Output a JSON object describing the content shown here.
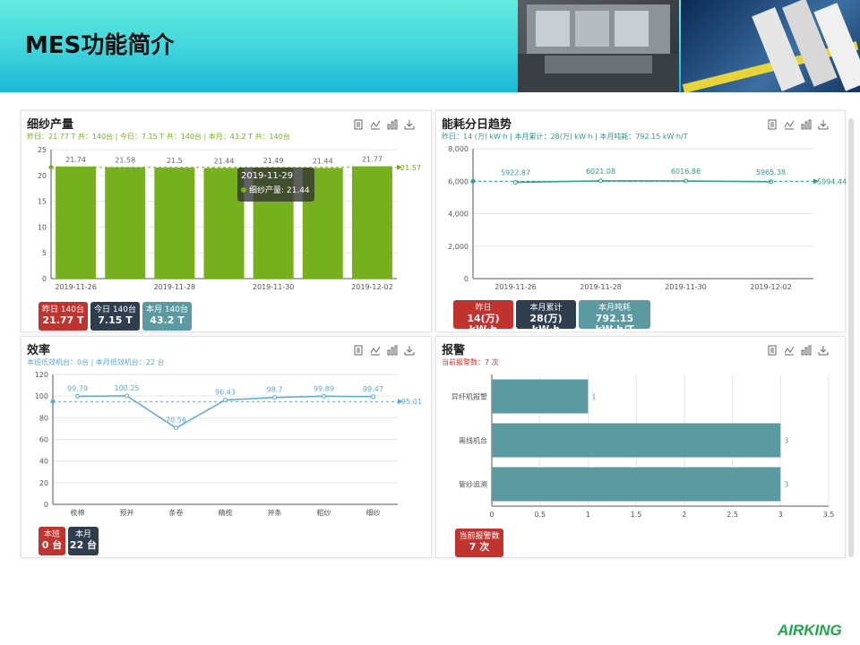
{
  "page": {
    "title": "MES功能简介",
    "logo": "AIRKING"
  },
  "colors": {
    "green": "#76b01e",
    "teal": "#2e9c86",
    "blue": "#5aa9d8",
    "slate": "#5b9aa0",
    "red": "#c1332f",
    "navy": "#2f3e4f"
  },
  "toolbar_icons": [
    "data-view-icon",
    "line-switch-icon",
    "bar-switch-icon",
    "download-icon"
  ],
  "yarn": {
    "title": "细纱产量",
    "summary": "昨日：21.77 T 共：140台 | 今日：7.15 T 共：140台 | 本月：43.2 T  共：140台",
    "tooltip": {
      "date": "2019-11-29",
      "text": "细纱产量: 21.44"
    },
    "badges": [
      {
        "label": "昨日 140台",
        "value": "21.77 T",
        "color": "#c1332f"
      },
      {
        "label": "今日 140台",
        "value": "7.15 T",
        "color": "#2f3e4f"
      },
      {
        "label": "本月 140台",
        "value": "43.2 T",
        "color": "#5b9aa0"
      }
    ]
  },
  "energy": {
    "title": "能耗分日趋势",
    "summary": "昨日：14 (万) kW·h | 本月累计：28(万) kW·h | 本月吨耗：792.15 kW·h/T",
    "badges": [
      {
        "label": "昨日",
        "value": "14(万) kW·h",
        "color": "#c1332f"
      },
      {
        "label": "本月累计",
        "value": "28(万) kW·h",
        "color": "#2f3e4f"
      },
      {
        "label": "本月吨耗",
        "value": "792.15 kW·h/T",
        "color": "#5b9aa0"
      }
    ]
  },
  "efficiency": {
    "title": "效率",
    "summary": "本班低效机台：0台 | 本月低效机台：22 台",
    "badges": [
      {
        "label": "本班",
        "value": "0 台",
        "color": "#c1332f"
      },
      {
        "label": "本月",
        "value": "22 台",
        "color": "#2f3e4f"
      }
    ]
  },
  "alarm": {
    "title": "报警",
    "summary": "当前报警数：7 次",
    "badges": [
      {
        "label": "当前报警数",
        "value": "7 次",
        "color": "#c1332f"
      }
    ]
  },
  "chart_data": [
    {
      "id": "yarn",
      "type": "bar",
      "categories": [
        "2019-11-26",
        "2019-11-27",
        "2019-11-28",
        "2019-11-29",
        "2019-11-30",
        "2019-12-01",
        "2019-12-02"
      ],
      "x_tick_labels": [
        "2019-11-26",
        "2019-11-28",
        "2019-11-30",
        "2019-12-02"
      ],
      "values": [
        21.74,
        21.58,
        21.5,
        21.44,
        21.49,
        21.44,
        21.77
      ],
      "average": 21.57,
      "ylim": [
        0,
        25
      ],
      "yticks": [
        0,
        5,
        10,
        15,
        20,
        25
      ],
      "grid": true
    },
    {
      "id": "energy",
      "type": "line",
      "x": [
        "2019-11-26",
        "2019-11-28",
        "2019-11-30",
        "2019-12-02"
      ],
      "values": [
        5922.87,
        6021.08,
        6016.86,
        5965.38
      ],
      "value_labels": [
        "5922.87",
        "6021.08",
        "6016.86",
        "5965.38"
      ],
      "average": 5994.44,
      "ylim": [
        0,
        8000
      ],
      "yticks": [
        0,
        2000,
        4000,
        6000,
        8000
      ],
      "ytick_labels": [
        "0",
        "2,000",
        "4,000",
        "6,000",
        "8,000"
      ],
      "grid": true
    },
    {
      "id": "efficiency",
      "type": "line",
      "categories": [
        "梳棉",
        "预并",
        "条卷",
        "精梳",
        "并条",
        "粗纱",
        "细纱"
      ],
      "values": [
        99.79,
        100.25,
        70.56,
        96.43,
        98.7,
        99.89,
        99.47
      ],
      "average": 95.01,
      "ylim": [
        0,
        120
      ],
      "yticks": [
        0,
        20,
        40,
        60,
        80,
        100,
        120
      ],
      "grid": true
    },
    {
      "id": "alarm",
      "type": "bar",
      "orientation": "horizontal",
      "categories": [
        "异纤机报警",
        "离线机台",
        "管纱追溯"
      ],
      "values": [
        1,
        3,
        3
      ],
      "xlim": [
        0,
        3.5
      ],
      "xticks": [
        0,
        0.5,
        1,
        1.5,
        2,
        2.5,
        3,
        3.5
      ],
      "grid": true
    }
  ]
}
